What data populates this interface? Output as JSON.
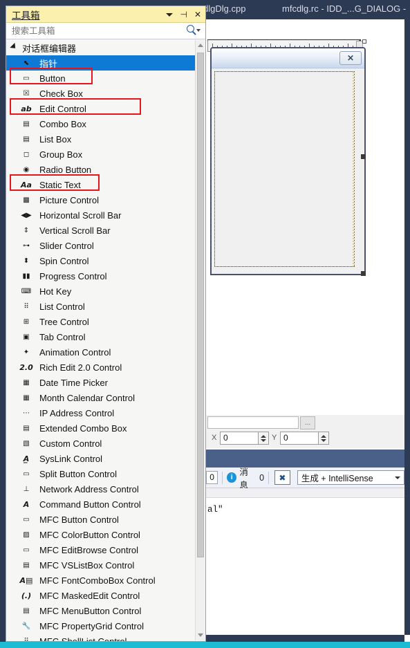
{
  "window": {
    "document_tabs": [
      {
        "label": "dlgDlg.cpp"
      },
      {
        "label": "mfcdlg.rc - IDD_...G_DIALOG -"
      }
    ]
  },
  "toolbox": {
    "title": "工具箱",
    "header_buttons": [
      {
        "name": "dropdown",
        "glyph": "▾"
      },
      {
        "name": "pin",
        "glyph": "⊣"
      },
      {
        "name": "close",
        "glyph": "✕"
      }
    ],
    "search": {
      "placeholder": "搜索工具箱",
      "value": "",
      "icon": "search-icon"
    },
    "group": {
      "label": "对话框编辑器",
      "expanded": true
    },
    "items": [
      {
        "label": "指针",
        "icon": "pointer",
        "selected": true,
        "highlighted": false
      },
      {
        "label": "Button",
        "icon": "button",
        "selected": false,
        "highlighted": true
      },
      {
        "label": "Check Box",
        "icon": "checkbox",
        "selected": false,
        "highlighted": false
      },
      {
        "label": "Edit Control",
        "icon": "ab",
        "selected": false,
        "highlighted": true
      },
      {
        "label": "Combo Box",
        "icon": "combobox",
        "selected": false,
        "highlighted": false
      },
      {
        "label": "List Box",
        "icon": "listbox",
        "selected": false,
        "highlighted": false
      },
      {
        "label": "Group Box",
        "icon": "groupbox",
        "selected": false,
        "highlighted": false
      },
      {
        "label": "Radio Button",
        "icon": "radio",
        "selected": false,
        "highlighted": false
      },
      {
        "label": "Static Text",
        "icon": "aa",
        "selected": false,
        "highlighted": true
      },
      {
        "label": "Picture Control",
        "icon": "picture",
        "selected": false,
        "highlighted": false
      },
      {
        "label": "Horizontal Scroll Bar",
        "icon": "hscroll",
        "selected": false,
        "highlighted": false
      },
      {
        "label": "Vertical Scroll Bar",
        "icon": "vscroll",
        "selected": false,
        "highlighted": false
      },
      {
        "label": "Slider Control",
        "icon": "slider",
        "selected": false,
        "highlighted": false
      },
      {
        "label": "Spin Control",
        "icon": "spin",
        "selected": false,
        "highlighted": false
      },
      {
        "label": "Progress Control",
        "icon": "progress",
        "selected": false,
        "highlighted": false
      },
      {
        "label": "Hot Key",
        "icon": "hotkey",
        "selected": false,
        "highlighted": false
      },
      {
        "label": "List Control",
        "icon": "listctrl",
        "selected": false,
        "highlighted": false
      },
      {
        "label": "Tree Control",
        "icon": "tree",
        "selected": false,
        "highlighted": false
      },
      {
        "label": "Tab Control",
        "icon": "tab",
        "selected": false,
        "highlighted": false
      },
      {
        "label": "Animation Control",
        "icon": "animation",
        "selected": false,
        "highlighted": false
      },
      {
        "label": "Rich Edit 2.0 Control",
        "icon": "richedit",
        "selected": false,
        "highlighted": false
      },
      {
        "label": "Date Time Picker",
        "icon": "datetime",
        "selected": false,
        "highlighted": false
      },
      {
        "label": "Month Calendar Control",
        "icon": "calendar",
        "selected": false,
        "highlighted": false
      },
      {
        "label": "IP Address Control",
        "icon": "ipaddress",
        "selected": false,
        "highlighted": false
      },
      {
        "label": "Extended Combo Box",
        "icon": "extcombo",
        "selected": false,
        "highlighted": false
      },
      {
        "label": "Custom Control",
        "icon": "custom",
        "selected": false,
        "highlighted": false
      },
      {
        "label": "SysLink Control",
        "icon": "syslink",
        "selected": false,
        "highlighted": false
      },
      {
        "label": "Split Button Control",
        "icon": "splitbutton",
        "selected": false,
        "highlighted": false
      },
      {
        "label": "Network Address Control",
        "icon": "network",
        "selected": false,
        "highlighted": false
      },
      {
        "label": "Command Button Control",
        "icon": "commandbutton",
        "selected": false,
        "highlighted": false
      },
      {
        "label": "MFC Button Control",
        "icon": "mfcbutton",
        "selected": false,
        "highlighted": false
      },
      {
        "label": "MFC ColorButton Control",
        "icon": "colorbutton",
        "selected": false,
        "highlighted": false
      },
      {
        "label": "MFC EditBrowse Control",
        "icon": "editbrowse",
        "selected": false,
        "highlighted": false
      },
      {
        "label": "MFC VSListBox Control",
        "icon": "vslistbox",
        "selected": false,
        "highlighted": false
      },
      {
        "label": "MFC FontComboBox Control",
        "icon": "fontcombo",
        "selected": false,
        "highlighted": false
      },
      {
        "label": "MFC MaskedEdit Control",
        "icon": "maskededit",
        "selected": false,
        "highlighted": false
      },
      {
        "label": "MFC MenuButton Control",
        "icon": "menubutton",
        "selected": false,
        "highlighted": false
      },
      {
        "label": "MFC PropertyGrid Control",
        "icon": "propertygrid",
        "selected": false,
        "highlighted": false
      },
      {
        "label": "MFC ShellList Control",
        "icon": "shelllist",
        "selected": false,
        "highlighted": false
      }
    ],
    "annotation_color": "#e8151c"
  },
  "designer": {
    "dialog_close_glyph": "✕",
    "dialog_close_name": "dialog-close-button"
  },
  "properties": {
    "browse_label": "...",
    "x_label": "X",
    "x_value": "0",
    "y_label": "Y",
    "y_value": "0"
  },
  "error_list": {
    "count_partial": "0",
    "messages_label": "消息",
    "messages_count": "0",
    "filter_icon": "filter-icon",
    "scope_value": "生成 + IntelliSense",
    "row_text": "al\""
  },
  "colors": {
    "toolbox_header": "#fbf0ad",
    "selection_blue": "#0f7ad6",
    "vs_chrome": "#2d3a53",
    "status_bar": "#1dbcd4",
    "annotation_red": "#e8151c"
  }
}
